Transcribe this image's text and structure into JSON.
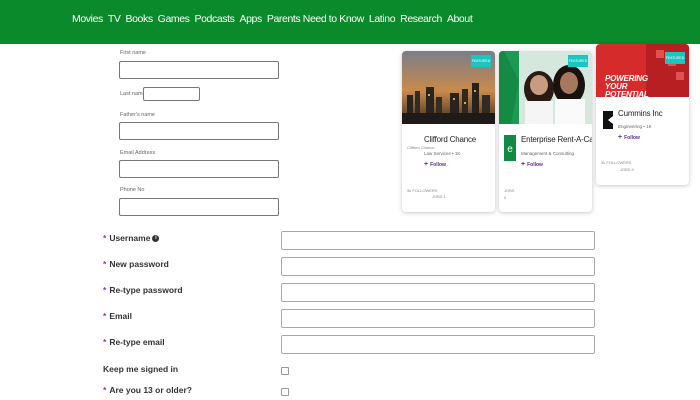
{
  "nav": {
    "items": [
      "Movies",
      "TV",
      "Books",
      "Games",
      "Podcasts",
      "Apps",
      "Parents Need to Know",
      "Latino",
      "Research",
      "About"
    ]
  },
  "mini_form": {
    "first_name": "First name",
    "last_name": "Last name",
    "father_name": "Father's name",
    "email": "Email Address",
    "phone": "Phone No"
  },
  "cards": [
    {
      "tag": "FEATURED",
      "logo": "Clifford Chance",
      "name": "Clifford Chance",
      "industry": "Law Services • 1K",
      "follow": "Follow",
      "stats": [
        "5k FOLLOWERS",
        "JOBS 1"
      ]
    },
    {
      "tag": "FEATURED",
      "name": "Enterprise Rent-A-Car",
      "industry": "Management & Consulting",
      "follow": "Follow",
      "stats": [
        "JOBS",
        "0"
      ]
    },
    {
      "tag": "FEATURED",
      "banner": "POWERING YOUR POTENTIAL",
      "name": "Cummins Inc",
      "industry": "Engineering • 1K",
      "follow": "Follow",
      "stats": [
        "5k FOLLOWERS",
        "JOBS 9"
      ]
    }
  ],
  "form": {
    "username": "Username",
    "new_password": "New password",
    "retype_password": "Re-type password",
    "email": "Email",
    "retype_email": "Re-type email",
    "keep_signed": "Keep me signed in",
    "age_check": "Are you 13 or older?",
    "required_mark": "*",
    "info_glyph": "i"
  },
  "colors": {
    "nav_bg": "#0a8a2a",
    "featured_tag": "#19c6c0",
    "follow": "#5a2d91",
    "required": "#8a2be2"
  }
}
